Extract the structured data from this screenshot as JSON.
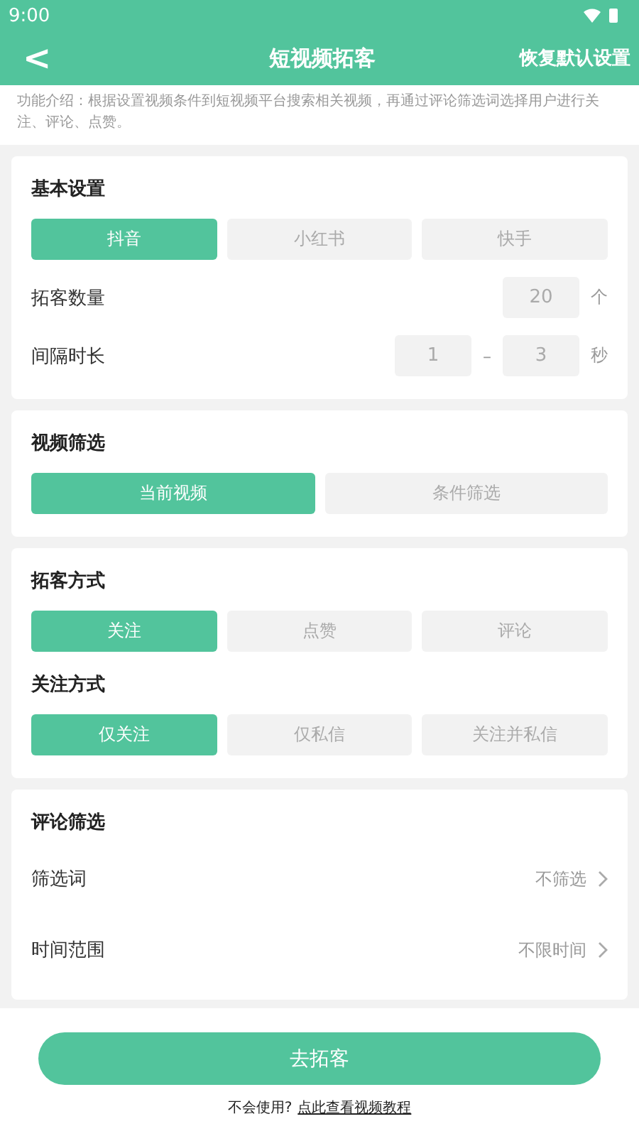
{
  "status_bar": {
    "time": "9:00"
  },
  "header": {
    "back": "<",
    "title": "短视频拓客",
    "action": "恢复默认设置"
  },
  "intro": "功能介绍：根据设置视频条件到短视频平台搜索相关视频，再通过评论筛选词选择用户进行关注、评论、点赞。",
  "sections": [
    {
      "title": "基本设置",
      "rows": [
        {
          "kind": "options",
          "options": [
            {
              "label": "抖音",
              "selected": true
            },
            {
              "label": "小红书",
              "selected": false
            },
            {
              "label": "快手",
              "selected": false
            }
          ]
        },
        {
          "kind": "number",
          "label": "拓客数量",
          "values": [
            "20"
          ],
          "unit": "个"
        },
        {
          "kind": "range",
          "label": "间隔时长",
          "values": [
            "1",
            "3"
          ],
          "separator": "–",
          "unit": "秒"
        }
      ]
    },
    {
      "title": "视频筛选",
      "rows": [
        {
          "kind": "options",
          "options": [
            {
              "label": "当前视频",
              "selected": true
            },
            {
              "label": "条件筛选",
              "selected": false
            }
          ]
        }
      ]
    },
    {
      "title": "拓客方式",
      "rows": [
        {
          "kind": "options",
          "options": [
            {
              "label": "关注",
              "selected": true
            },
            {
              "label": "点赞",
              "selected": false
            },
            {
              "label": "评论",
              "selected": false
            }
          ]
        },
        {
          "kind": "subtitle",
          "label": "关注方式"
        },
        {
          "kind": "options",
          "options": [
            {
              "label": "仅关注",
              "selected": true
            },
            {
              "label": "仅私信",
              "selected": false
            },
            {
              "label": "关注并私信",
              "selected": false
            }
          ]
        }
      ]
    },
    {
      "title": "评论筛选",
      "rows": [
        {
          "kind": "link",
          "label": "筛选词",
          "value": "不筛选"
        },
        {
          "kind": "link",
          "label": "时间范围",
          "value": "不限时间"
        }
      ]
    }
  ],
  "footer": {
    "button": "去拓客",
    "hint": "不会使用?",
    "link": "点此查看视频教程"
  }
}
